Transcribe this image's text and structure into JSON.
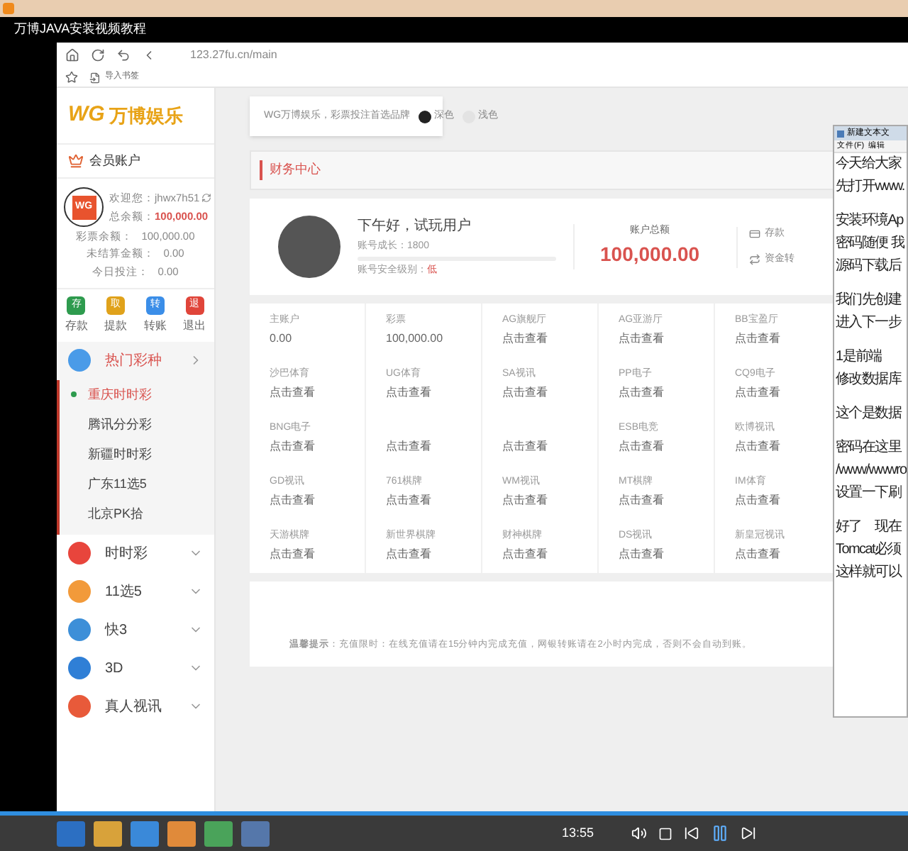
{
  "player": {
    "title": "万博JAVA安装视频教程",
    "time": "13:55"
  },
  "browser": {
    "url": "123.27fu.cn/main",
    "bookmark": "导入书签"
  },
  "sidebar": {
    "logo_mark": "WG",
    "logo_text": "万博娱乐",
    "section": "会员账户",
    "user": {
      "avatar": "WG",
      "welcome_label": "欢迎您：",
      "username": "jhwx7h51",
      "total_label": "总余额：",
      "total": "100,000.00",
      "stats": [
        {
          "label": "彩票余额：",
          "value": "100,000.00"
        },
        {
          "label": "未结算金额：",
          "value": "0.00"
        },
        {
          "label": "今日投注：",
          "value": "0.00"
        }
      ]
    },
    "actions": [
      {
        "glyph": "存",
        "label": "存款",
        "color": "#2e9b4e"
      },
      {
        "glyph": "取",
        "label": "提款",
        "color": "#e0a21b"
      },
      {
        "glyph": "转",
        "label": "转账",
        "color": "#3b8ee8"
      },
      {
        "glyph": "退",
        "label": "退出",
        "color": "#e0453a"
      }
    ],
    "menu": [
      {
        "label": "热门彩种",
        "expanded": true,
        "color": "#4a9be8",
        "children": [
          {
            "label": "重庆时时彩",
            "selected": true
          },
          {
            "label": "腾讯分分彩",
            "selected": false
          },
          {
            "label": "新疆时时彩",
            "selected": false
          },
          {
            "label": "广东11选5",
            "selected": false
          },
          {
            "label": "北京PK拾",
            "selected": false
          }
        ]
      },
      {
        "label": "时时彩",
        "expanded": false,
        "color": "#e8453c"
      },
      {
        "label": "11选5",
        "expanded": false,
        "color": "#f29a3a"
      },
      {
        "label": "快3",
        "expanded": false,
        "color": "#3d8fd8"
      },
      {
        "label": "3D",
        "expanded": false,
        "color": "#2f7fd6"
      },
      {
        "label": "真人视讯",
        "expanded": false,
        "color": "#e85a3a"
      }
    ]
  },
  "main": {
    "banner": {
      "text": "WG万博娱乐，彩票投注首选品牌",
      "themes": [
        {
          "label": "深色",
          "selected": true
        },
        {
          "label": "浅色",
          "selected": false
        }
      ]
    },
    "section_title": "财务中心",
    "profile": {
      "greeting": "下午好，试玩用户",
      "growth": "账号成长：1800",
      "security_label": "账号安全级别：",
      "security": "低",
      "total_label": "账户总额",
      "total": "100,000.00",
      "links": [
        "存款",
        "资金转"
      ]
    },
    "wallet_rows": [
      [
        {
          "label": "主账户",
          "value": "0.00"
        },
        {
          "label": "彩票",
          "value": "100,000.00"
        },
        {
          "label": "AG旗舰厅",
          "value": "点击查看"
        },
        {
          "label": "AG亚游厅",
          "value": "点击查看"
        },
        {
          "label": "BB宝盈厅",
          "value": "点击查看"
        }
      ],
      [
        {
          "label": "沙巴体育",
          "value": "点击查看"
        },
        {
          "label": "UG体育",
          "value": "点击查看"
        },
        {
          "label": "SA视讯",
          "value": "点击查看"
        },
        {
          "label": "PP电子",
          "value": "点击查看"
        },
        {
          "label": "CQ9电子",
          "value": "点击查看"
        }
      ],
      [
        {
          "label": "BNG电子",
          "value": "点击查看"
        },
        {
          "value": "点击查看"
        },
        {
          "value": "点击查看"
        },
        {
          "label": "ESB电竞",
          "value": "点击查看"
        },
        {
          "label": "欧博视讯",
          "value": "点击查看"
        }
      ],
      [
        {
          "label": "GD视讯",
          "value": "点击查看"
        },
        {
          "label": "761棋牌",
          "value": "点击查看"
        },
        {
          "label": "WM视讯",
          "value": "点击查看"
        },
        {
          "label": "MT棋牌",
          "value": "点击查看"
        },
        {
          "label": "IM体育",
          "value": "点击查看"
        }
      ],
      [
        {
          "label": "天游棋牌",
          "value": "点击查看"
        },
        {
          "label": "新世界棋牌",
          "value": "点击查看"
        },
        {
          "label": "财神棋牌",
          "value": "点击查看"
        },
        {
          "label": "DS视讯",
          "value": "点击查看"
        },
        {
          "label": "新皇冠视讯",
          "value": "点击查看"
        }
      ]
    ],
    "notice": "**温馨提示**：充值限时：在线充值请在15分钟内完成充值，网银转账请在2小时内完成，否则不会自动到账。"
  },
  "notepad": {
    "title": "新建文本文",
    "menu": [
      "文件(F)",
      "编辑"
    ],
    "paragraphs": [
      [
        "今天给大家",
        "先打开www."
      ],
      [
        "安装环境Ap",
        "密码随便 我",
        "源码下载后"
      ],
      [
        "我们先创建",
        "进入下一步"
      ],
      [
        "1是前端",
        "修改数据库"
      ],
      [
        "这个是数据"
      ],
      [
        "密码在这里",
        "/www/wwwro",
        "设置一下刷"
      ],
      [
        "好了　现在",
        "Tomcat必须",
        "这样就可以"
      ]
    ]
  }
}
